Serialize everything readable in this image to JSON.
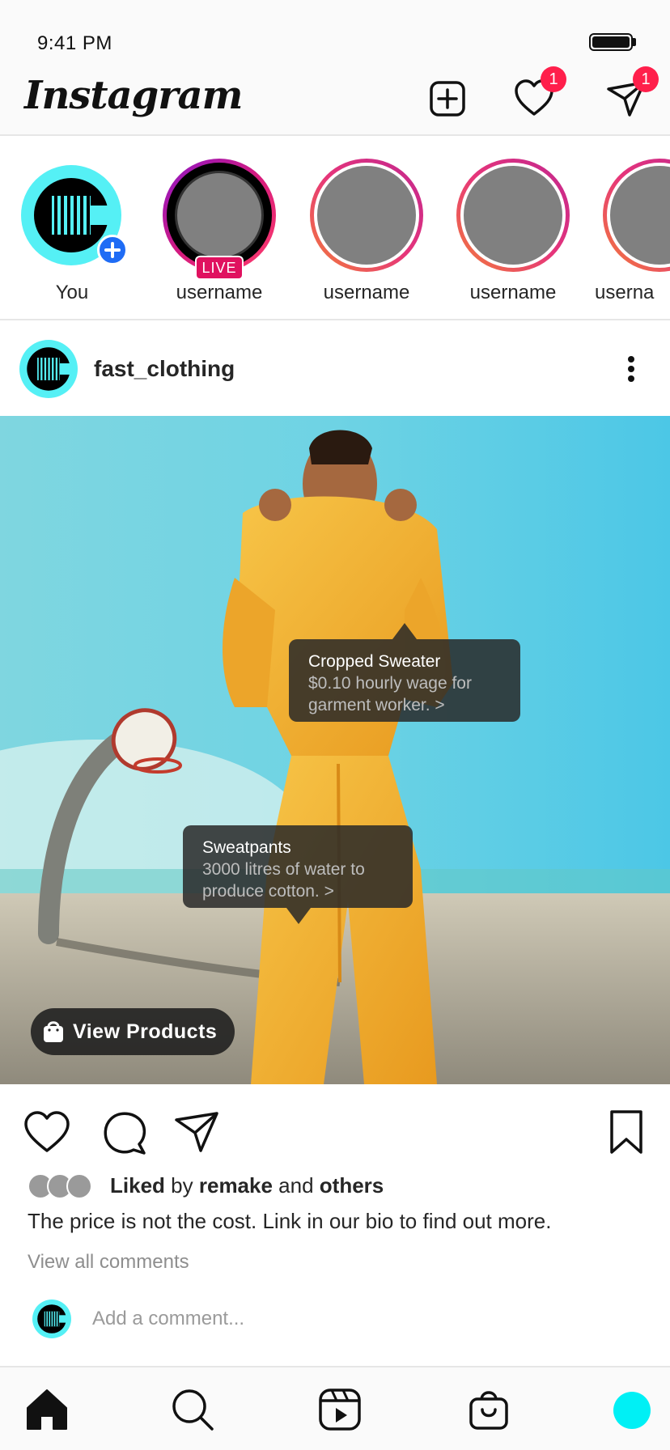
{
  "status_bar": {
    "time": "9:41 PM"
  },
  "header": {
    "logo": "Instagram",
    "activity_badge": "1",
    "messages_badge": "1"
  },
  "stories": {
    "you_label": "You",
    "live_label": "LIVE",
    "items": [
      {
        "label": "username",
        "live": true
      },
      {
        "label": "username",
        "live": false
      },
      {
        "label": "username",
        "live": false
      },
      {
        "label": "userna",
        "live": false
      }
    ]
  },
  "post": {
    "username": "fast_clothing",
    "tags": [
      {
        "title": "Cropped Sweater",
        "desc_line1": "$0.10 hourly wage for",
        "desc_line2": "garment worker. >"
      },
      {
        "title": "Sweatpants",
        "desc_line1": "3000 litres of water to",
        "desc_line2": "produce cotton. >"
      }
    ],
    "view_products": "View Products",
    "likes": {
      "prefix": "Liked",
      "by": "by",
      "user": "remake",
      "and": "and",
      "others": "others"
    },
    "caption": "The price is not the cost. Link in our bio to find out more.",
    "view_comments": "View all comments",
    "comment_placeholder": "Add a comment..."
  },
  "colors": {
    "accent_cyan": "#55f0f5",
    "badge_red": "#ff1f4b",
    "live_pink": "#e0115f",
    "plus_blue": "#1f6cf5",
    "sky": "#5fd0e8",
    "outfit_yellow": "#f5b731"
  },
  "icons": {
    "header": [
      "new-post-icon",
      "heart-icon",
      "direct-message-icon"
    ],
    "actions": [
      "like-icon",
      "comment-icon",
      "share-icon",
      "bookmark-icon"
    ],
    "nav": [
      "home-icon",
      "search-icon",
      "reels-icon",
      "shop-icon",
      "profile-avatar"
    ]
  }
}
